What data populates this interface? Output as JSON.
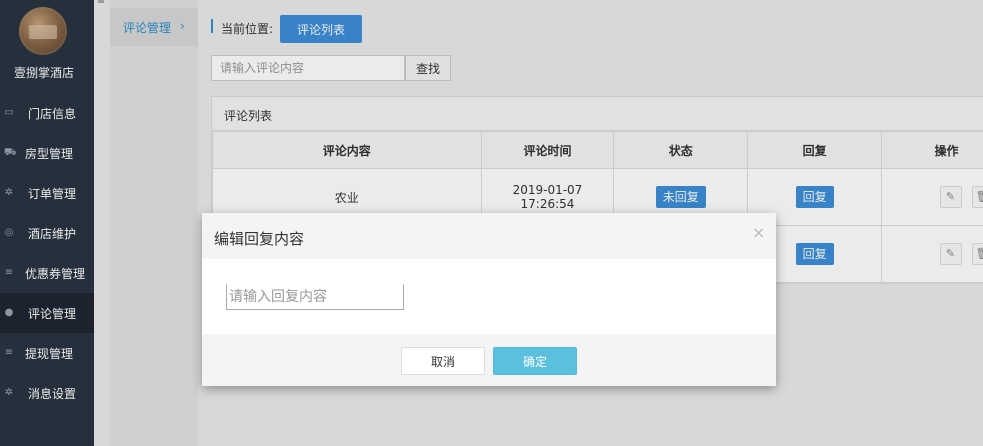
{
  "sidebar": {
    "hotel_name": "壹捌掌酒店",
    "items": [
      {
        "label": "门店信息",
        "icon": "storefront-icon"
      },
      {
        "label": "房型管理",
        "icon": "cart-icon"
      },
      {
        "label": "订单管理",
        "icon": "gear-icon"
      },
      {
        "label": "酒店维护",
        "icon": "compass-icon"
      },
      {
        "label": "优惠券管理",
        "icon": "list-icon"
      },
      {
        "label": "评论管理",
        "icon": "user-icon",
        "active": true
      },
      {
        "label": "提现管理",
        "icon": "list-icon"
      },
      {
        "label": "消息设置",
        "icon": "gear-icon"
      }
    ]
  },
  "submenu": {
    "item_label": "评论管理",
    "chevron": "›"
  },
  "breadcrumb": {
    "label": "当前位置:",
    "current": "评论列表"
  },
  "search": {
    "placeholder": "请输入评论内容",
    "button_label": "查找"
  },
  "panel": {
    "title": "评论列表"
  },
  "table": {
    "headers": [
      "评论内容",
      "评论时间",
      "状态",
      "回复",
      "操作"
    ],
    "rows": [
      {
        "content": "农业",
        "date": "2019-01-07",
        "time": "17:26:54",
        "status": "未回复",
        "reply": "回复"
      },
      {
        "content": "",
        "date": "",
        "time": "",
        "status": "",
        "reply": "回复"
      }
    ]
  },
  "modal": {
    "title": "编辑回复内容",
    "close": "×",
    "input_placeholder": "请输入回复内容",
    "cancel_label": "取消",
    "ok_label": "确定"
  },
  "colors": {
    "sidebar_bg": "#2a3542",
    "accent": "#3d8fd8",
    "ok_button": "#5bc0de"
  }
}
